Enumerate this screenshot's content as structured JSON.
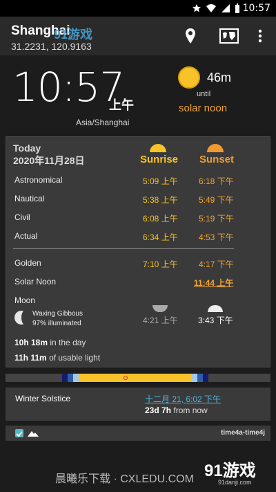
{
  "status_bar": {
    "time": "10:57",
    "icons": [
      "star-icon",
      "wifi-icon",
      "signal-icon",
      "battery-icon"
    ]
  },
  "appbar": {
    "location_name": "Shanghai",
    "coordinates": "31.2231, 120.9163",
    "watermark_logo": "91游戏"
  },
  "clock": {
    "time": "10:57",
    "ampm": "上午",
    "timezone": "Asia/Shanghai",
    "delta": "46m",
    "until": "until",
    "event": "solar noon"
  },
  "card": {
    "today": "Today",
    "date": "2020年11月28日",
    "sunrise_header": "Sunrise",
    "sunset_header": "Sunset",
    "rows": [
      {
        "label": "Astronomical",
        "rise": "5:09 上午",
        "set": "6:18 下午"
      },
      {
        "label": "Nautical",
        "rise": "5:38 上午",
        "set": "5:49 下午"
      },
      {
        "label": "Civil",
        "rise": "6:08 上午",
        "set": "5:19 下午"
      },
      {
        "label": "Actual",
        "rise": "6:34 上午",
        "set": "4:53 下午"
      }
    ],
    "golden": {
      "label": "Golden",
      "rise": "7:10 上午",
      "set": "4:17 下午"
    },
    "noon": {
      "label": "Solar Noon",
      "value": "11:44 上午"
    },
    "moon": {
      "label": "Moon",
      "phase": "Waxing Gibbous",
      "illumination": "97% illuminated",
      "rise": "4:21 上午",
      "set": "3:43 下午"
    },
    "day_length": {
      "value": "10h 18m",
      "text": "in the day"
    },
    "usable_light": {
      "value": "11h 11m",
      "text": "of usable light"
    }
  },
  "timeline": {
    "now_fraction": 0.45
  },
  "solstice": {
    "name": "Winter Solstice",
    "date": "十二月 21, 6:02 下午",
    "away_value": "23d 7h",
    "away_text": "from now"
  },
  "bottombar": {
    "format": "time4a-time4j"
  },
  "watermark": {
    "text": "晨曦乐下载 · CXLEDU.COM",
    "brand": "91游戏",
    "brand_url": "91danji.com"
  },
  "colors": {
    "sun": "#f7c22a",
    "sunset": "#f2a431",
    "link": "#4db8e8",
    "background": "#1c1c1c"
  }
}
